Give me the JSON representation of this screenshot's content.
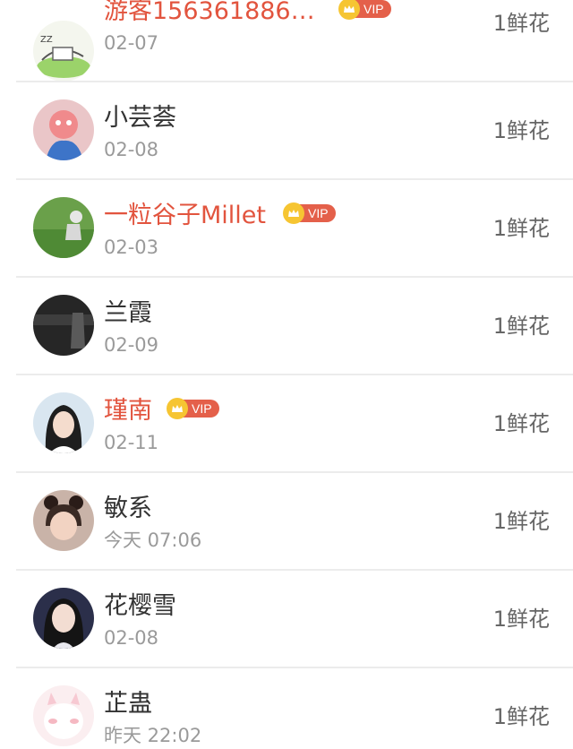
{
  "gift_label": "1鲜花",
  "vip_label": "VIP",
  "colors": {
    "vip_name": "#e2543e",
    "vip_badge": "#e4604a",
    "crown": "#f6c532",
    "normal_name": "#333333",
    "time": "#9a9a9a"
  },
  "records": [
    {
      "name": "游客156361886…",
      "time": "02-07",
      "vip": true,
      "gift": "1鲜花",
      "avatar": "cartoon-sketch"
    },
    {
      "name": "小芸荟",
      "time": "02-08",
      "vip": false,
      "gift": "1鲜花",
      "avatar": "cartoon-pig"
    },
    {
      "name": "一粒谷子Millet",
      "time": "02-03",
      "vip": true,
      "gift": "1鲜花",
      "avatar": "field-photo"
    },
    {
      "name": "兰霞",
      "time": "02-09",
      "vip": false,
      "gift": "1鲜花",
      "avatar": "dark-photo"
    },
    {
      "name": "瑾南",
      "time": "02-11",
      "vip": true,
      "gift": "1鲜花",
      "avatar": "girl-portrait"
    },
    {
      "name": "敏系",
      "time": "今天 07:06",
      "vip": false,
      "gift": "1鲜花",
      "avatar": "child-portrait"
    },
    {
      "name": "花樱雪",
      "time": "02-08",
      "vip": false,
      "gift": "1鲜花",
      "avatar": "woman-portrait"
    },
    {
      "name": "芷蛊",
      "time": "昨天 22:02",
      "vip": false,
      "gift": "1鲜花",
      "avatar": "pink-cartoon"
    }
  ]
}
